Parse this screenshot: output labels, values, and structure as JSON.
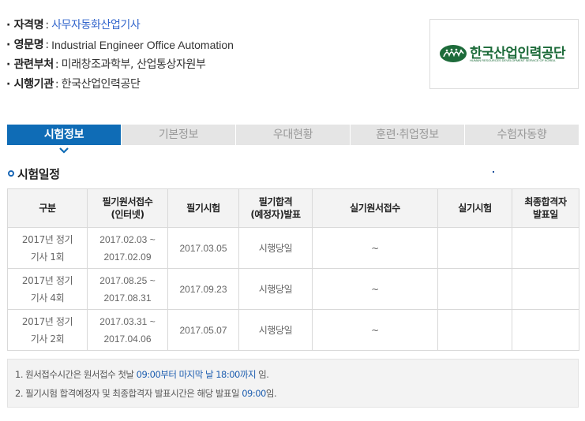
{
  "info": [
    {
      "label": "· 자격명",
      "sep": ":",
      "value": "사무자동화산업기사"
    },
    {
      "label": "· 영문명",
      "sep": ":",
      "value": "Industrial Engineer Office Automation"
    },
    {
      "label": "· 관련부처",
      "sep": ":",
      "value": "미래창조과학부, 산업통상자원부"
    },
    {
      "label": "· 시행기관",
      "sep": ":",
      "value": "한국산업인력공단"
    }
  ],
  "logo": {
    "name": "한국산업인력공단",
    "sub": "HUMAN RESOURCES DEVELOPMENT SERVICE OF KOREA",
    "color": "#1d6b3a"
  },
  "tabs": [
    {
      "label": "시험정보",
      "active": true
    },
    {
      "label": "기본정보",
      "active": false
    },
    {
      "label": "우대현황",
      "active": false
    },
    {
      "label": "훈련·취업정보",
      "active": false
    },
    {
      "label": "수험자동향",
      "active": false
    }
  ],
  "section": {
    "title": "시험일정"
  },
  "table": {
    "headers": [
      "구분",
      "필기원서접수\n(인터넷)",
      "필기시험",
      "필기합격\n(예정자)발표",
      "실기원서접수",
      "실기시험",
      "최종합격자\n발표일"
    ],
    "rows": [
      {
        "cat": "2017년 정기\n기사 1회",
        "reg": "2017.02.03 ~\n2017.02.09",
        "exam": "2017.03.05",
        "result": "시행당일",
        "prac_reg": "~",
        "prac_exam": "",
        "final": ""
      },
      {
        "cat": "2017년 정기\n기사 4회",
        "reg": "2017.08.25 ~\n2017.08.31",
        "exam": "2017.09.23",
        "result": "시행당일",
        "prac_reg": "~",
        "prac_exam": "",
        "final": ""
      },
      {
        "cat": "2017년 정기\n기사 2회",
        "reg": "2017.03.31 ~\n2017.04.06",
        "exam": "2017.05.07",
        "result": "시행당일",
        "prac_reg": "~",
        "prac_exam": "",
        "final": ""
      }
    ]
  },
  "notes": {
    "n1_a": "1. 원서접수시간은 원서접수 첫날 ",
    "n1_b": "09:00부터 마지막 날 18:00까지",
    "n1_c": " 임.",
    "n2_a": "2. 필기시험 합격예정자 및 최종합격자 발표시간은 해당 발표일 ",
    "n2_b": "09:00",
    "n2_c": "임."
  },
  "colors": {
    "tab_active": "#0f6cb6",
    "tab_inactive": "#e5e5e5",
    "highlight": "#1f5fb0"
  }
}
